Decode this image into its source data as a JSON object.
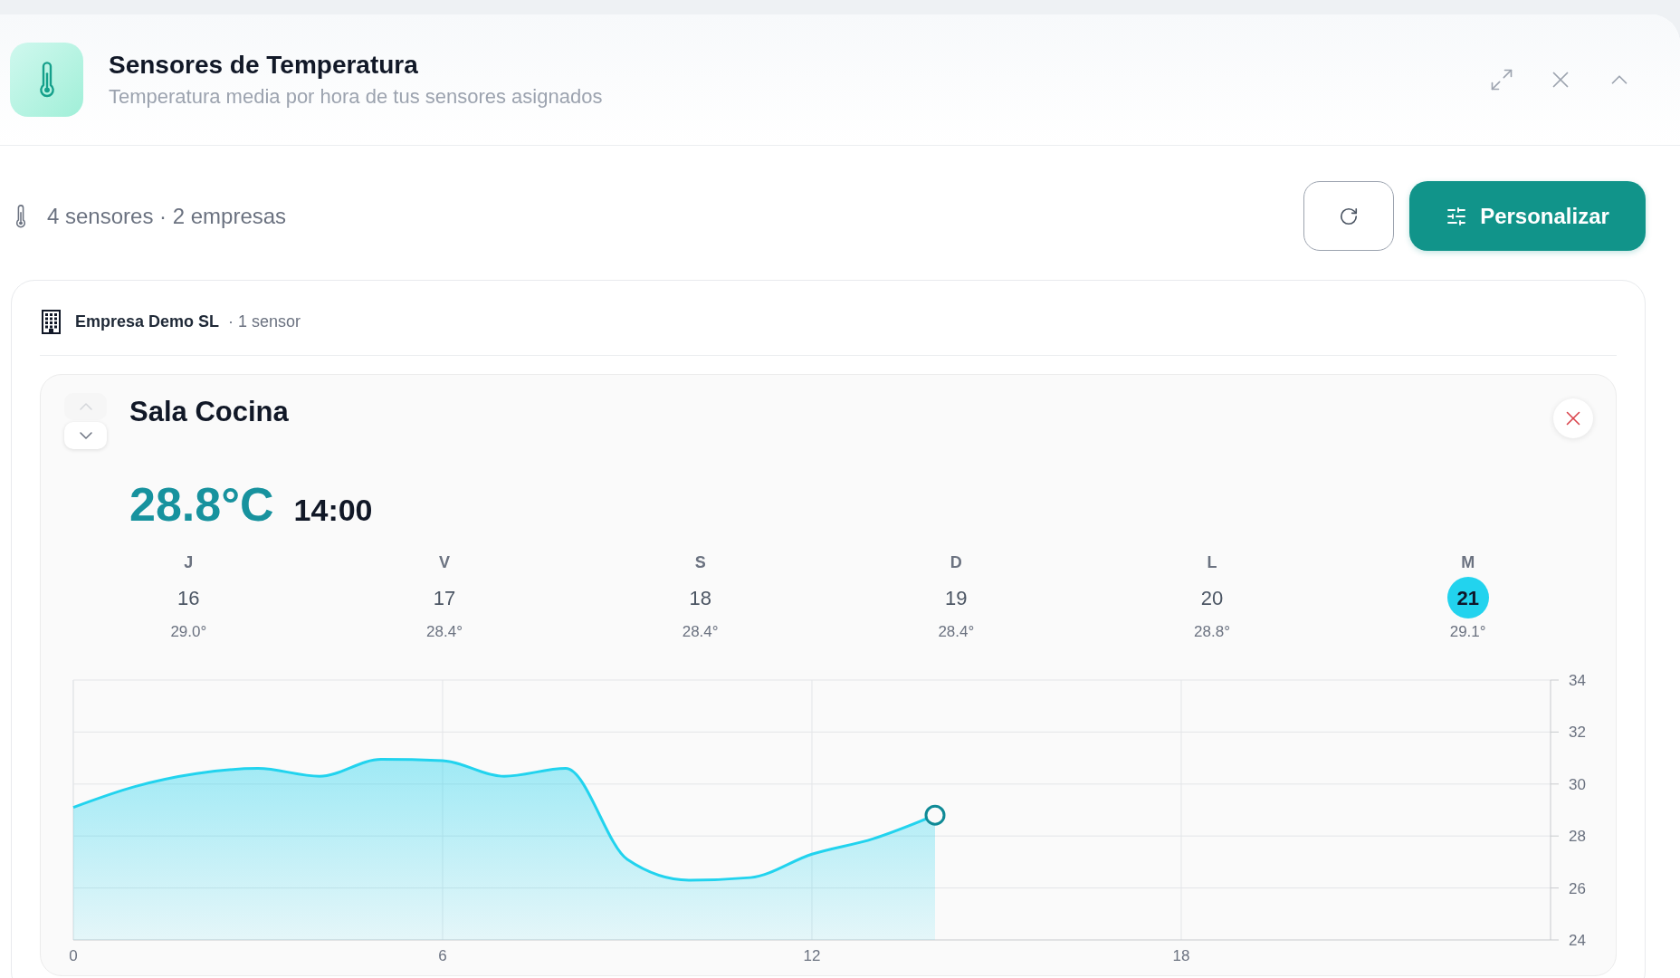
{
  "panel": {
    "title": "Sensores de Temperatura",
    "subtitle": "Temperatura media por hora de tus sensores asignados"
  },
  "toolbar": {
    "summary": "4 sensores · 2 empresas",
    "customize_button": "Personalizar"
  },
  "companies": [
    {
      "name": "Empresa Demo SL",
      "sensor_count": "· 1 sensor",
      "sensors": [
        {
          "name": "Sala Cocina",
          "move_buttons": [
            {
              "kind": "up",
              "disabled": true
            },
            {
              "kind": "down",
              "disabled": false
            }
          ],
          "temperature": "28.8°C",
          "time": "14:00",
          "days": [
            {
              "weekday": "J",
              "day": "16",
              "average": "29.0°",
              "selected": false
            },
            {
              "weekday": "V",
              "day": "17",
              "average": "28.4°",
              "selected": false
            },
            {
              "weekday": "S",
              "day": "18",
              "average": "28.4°",
              "selected": false
            },
            {
              "weekday": "D",
              "day": "19",
              "average": "28.4°",
              "selected": false
            },
            {
              "weekday": "L",
              "day": "20",
              "average": "28.8°",
              "selected": false
            },
            {
              "weekday": "M",
              "day": "21",
              "average": "29.1°",
              "selected": true
            }
          ],
          "chart_data": {
            "type": "area",
            "x": [
              0,
              1,
              2,
              3,
              4,
              5,
              6,
              7,
              8,
              9,
              10,
              11,
              12,
              13,
              14
            ],
            "series": [
              {
                "color": "#22d3ee",
                "values": [
                  29.1,
                  29.9,
                  30.4,
                  30.6,
                  30.3,
                  30.95,
                  30.9,
                  30.3,
                  30.6,
                  27.1,
                  26.3,
                  26.4,
                  27.3,
                  27.9,
                  28.8
                ]
              }
            ],
            "xlim": [
              0,
              24
            ],
            "ylim": [
              24,
              34
            ],
            "xticks": [
              0,
              6,
              12,
              18
            ],
            "yticks": [
              24,
              26,
              28,
              30,
              32,
              34
            ],
            "grid": true
          }
        }
      ]
    }
  ]
}
